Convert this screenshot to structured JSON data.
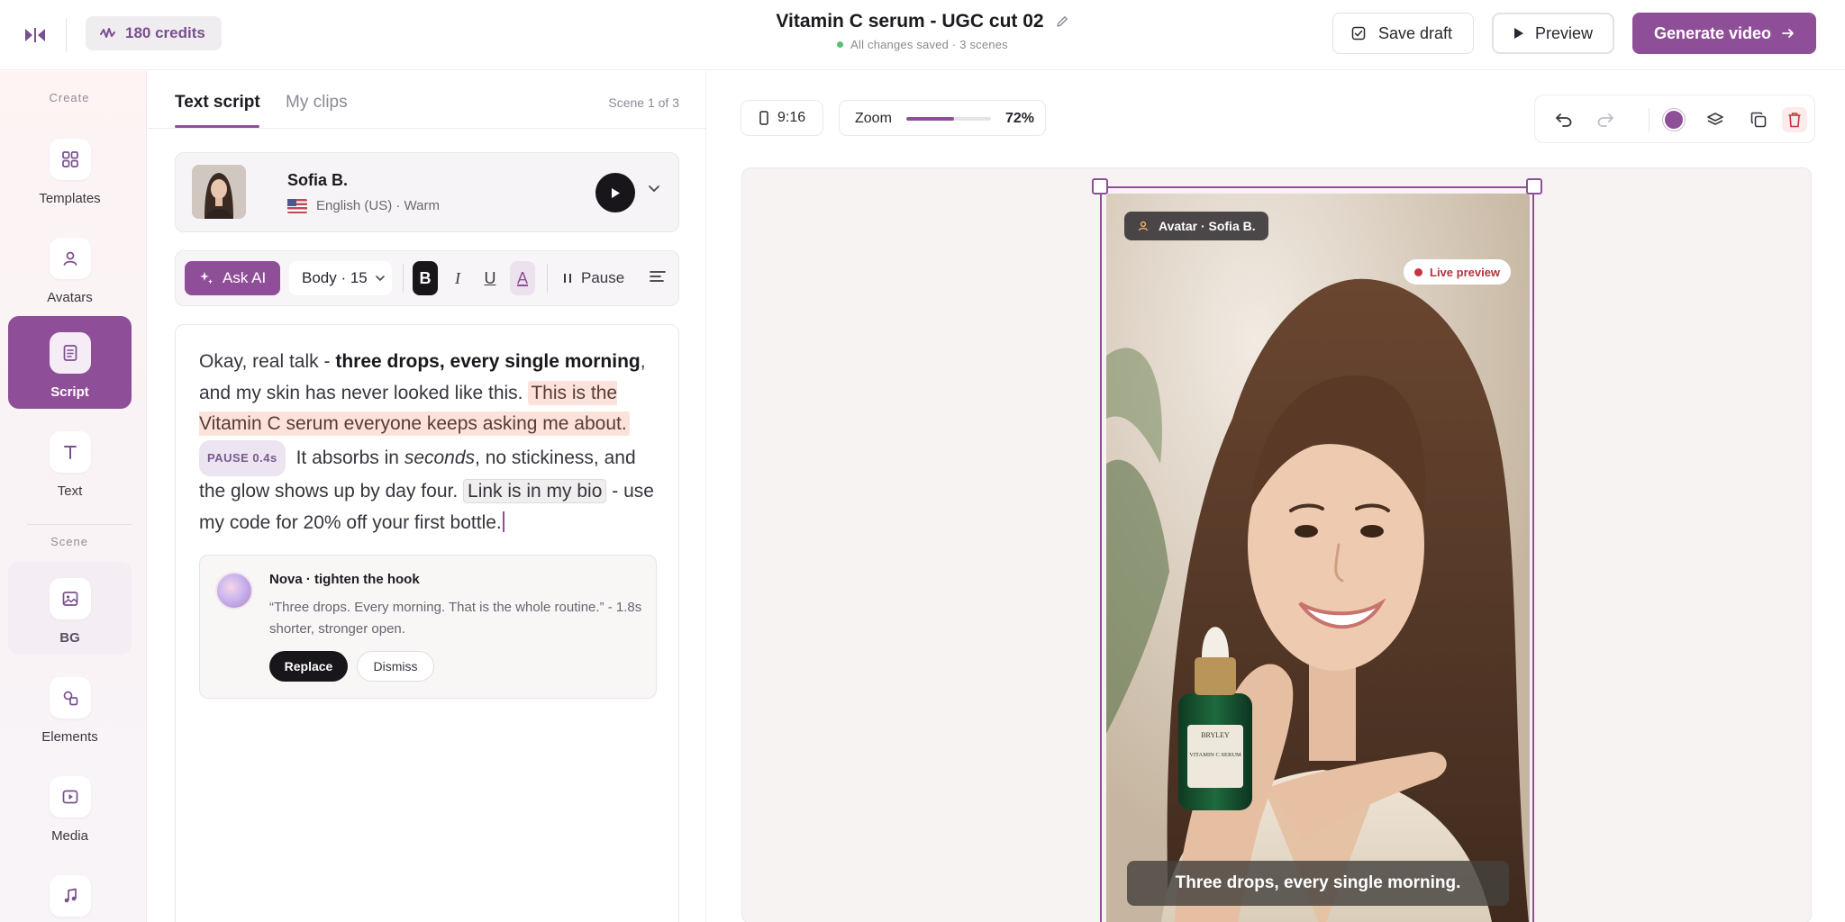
{
  "app": {
    "credits": "180 credits",
    "project_title": "Vitamin C serum - UGC cut 02",
    "save_status": "All changes saved · 3 scenes",
    "save_draft_label": "Save draft",
    "preview_label": "Preview",
    "generate_label": "Generate video"
  },
  "rail": {
    "create_heading": "Create",
    "scene_heading": "Scene",
    "items": [
      {
        "label": "Templates",
        "icon": "grid-icon"
      },
      {
        "label": "Avatars",
        "icon": "person-icon"
      },
      {
        "label": "Script",
        "icon": "document-icon"
      },
      {
        "label": "Text",
        "icon": "text-icon"
      },
      {
        "label": "BG",
        "icon": "image-icon"
      },
      {
        "label": "Elements",
        "icon": "shapes-icon"
      },
      {
        "label": "Media",
        "icon": "play-icon"
      },
      {
        "label": "",
        "icon": "music-icon"
      }
    ]
  },
  "panel": {
    "tab_script": "Text script",
    "tab_clips": "My clips",
    "scene_counter": "Scene 1 of 3",
    "voice": {
      "name": "Sofia B.",
      "language": "English (US) · Warm"
    },
    "toolbar": {
      "ask_ai": "Ask AI",
      "text_style": "Body · 15",
      "bold": "B",
      "italic": "I",
      "underline": "U",
      "text_color": "A",
      "pause": "Pause"
    },
    "script": {
      "s1": "Okay, real talk - ",
      "s2_bold": "three drops, every single morning",
      "s3": ", and my skin has never looked like this. ",
      "s4_highlight": "This is the Vitamin C serum everyone keeps asking me about.",
      "pause_tag": "PAUSE 0.4s",
      "s5": " It absorbs in ",
      "s6_italic": "seconds",
      "s7": ", no stickiness, and the glow shows up by day four. ",
      "s8_link": "Link is in my bio",
      "s9": " - use my code for 20% off your first bottle."
    },
    "nova": {
      "title": "Nova · tighten the hook",
      "body": "“Three drops. Every morning. That is the whole routine.” - 1.8s shorter, stronger open.",
      "replace_label": "Replace",
      "dismiss_label": "Dismiss"
    }
  },
  "canvas": {
    "aspect_ratio": "9:16",
    "zoom_label": "Zoom",
    "zoom_value": "72%",
    "zoom_fraction": 0.56,
    "avatar_tag": "Avatar · Sofia B.",
    "live_tag": "Live preview",
    "caption": "Three drops, every single morning.",
    "bottle_label": "VITAMIN C SERUM",
    "bottle_brand": "BRYLEY"
  },
  "colors": {
    "accent": "#8f4f98",
    "highlight": "#fbe3dc",
    "live": "#c8353f"
  }
}
